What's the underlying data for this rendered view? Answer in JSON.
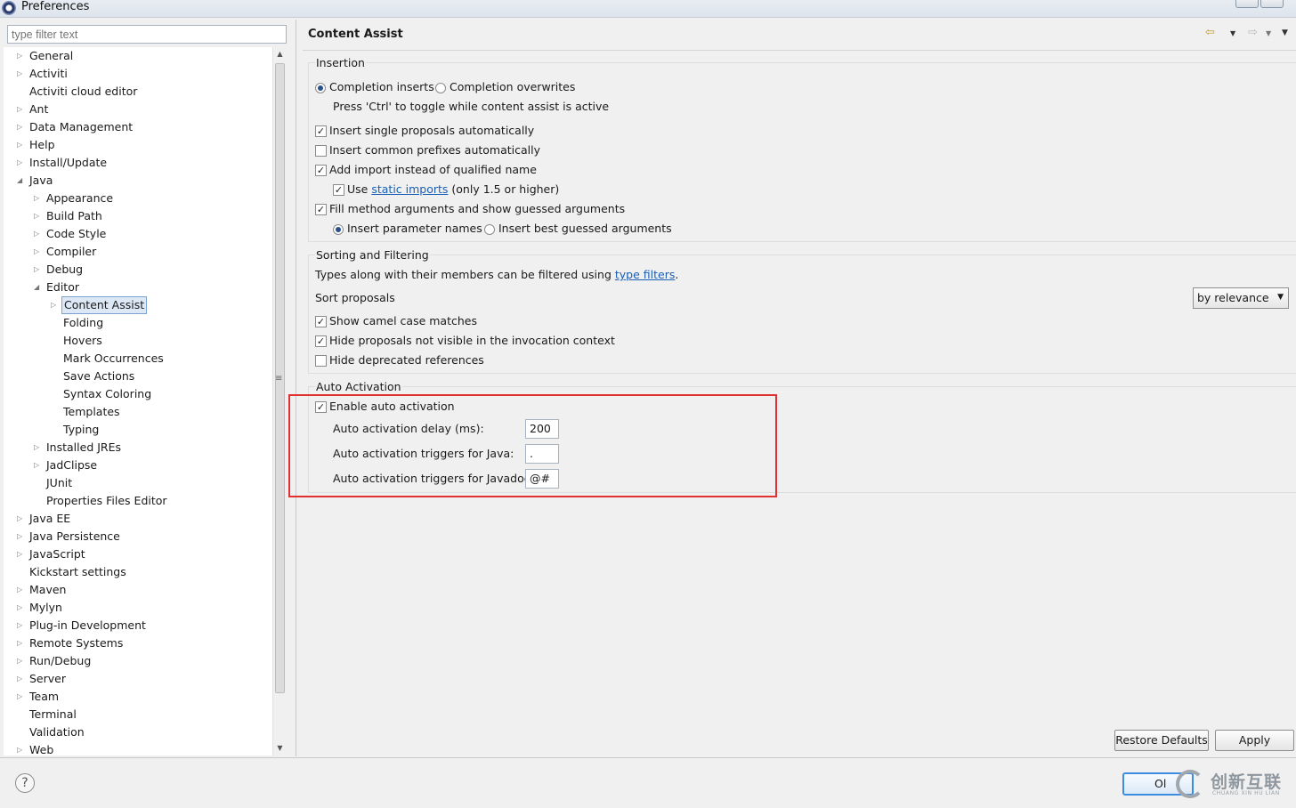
{
  "window": {
    "title": "Preferences",
    "icon": "eclipse-icon"
  },
  "filter": {
    "placeholder": "type filter text"
  },
  "tree": [
    {
      "label": "General",
      "level": 0,
      "arrow": "collapsed"
    },
    {
      "label": "Activiti",
      "level": 0,
      "arrow": "collapsed"
    },
    {
      "label": "Activiti cloud editor",
      "level": 0,
      "arrow": "none"
    },
    {
      "label": "Ant",
      "level": 0,
      "arrow": "collapsed"
    },
    {
      "label": "Data Management",
      "level": 0,
      "arrow": "collapsed"
    },
    {
      "label": "Help",
      "level": 0,
      "arrow": "collapsed"
    },
    {
      "label": "Install/Update",
      "level": 0,
      "arrow": "collapsed"
    },
    {
      "label": "Java",
      "level": 0,
      "arrow": "expanded"
    },
    {
      "label": "Appearance",
      "level": 1,
      "arrow": "collapsed"
    },
    {
      "label": "Build Path",
      "level": 1,
      "arrow": "collapsed"
    },
    {
      "label": "Code Style",
      "level": 1,
      "arrow": "collapsed"
    },
    {
      "label": "Compiler",
      "level": 1,
      "arrow": "collapsed"
    },
    {
      "label": "Debug",
      "level": 1,
      "arrow": "collapsed"
    },
    {
      "label": "Editor",
      "level": 1,
      "arrow": "expanded"
    },
    {
      "label": "Content Assist",
      "level": 2,
      "arrow": "collapsed",
      "selected": true
    },
    {
      "label": "Folding",
      "level": 2,
      "arrow": "none"
    },
    {
      "label": "Hovers",
      "level": 2,
      "arrow": "none"
    },
    {
      "label": "Mark Occurrences",
      "level": 2,
      "arrow": "none"
    },
    {
      "label": "Save Actions",
      "level": 2,
      "arrow": "none"
    },
    {
      "label": "Syntax Coloring",
      "level": 2,
      "arrow": "none"
    },
    {
      "label": "Templates",
      "level": 2,
      "arrow": "none"
    },
    {
      "label": "Typing",
      "level": 2,
      "arrow": "none"
    },
    {
      "label": "Installed JREs",
      "level": 1,
      "arrow": "collapsed"
    },
    {
      "label": "JadClipse",
      "level": 1,
      "arrow": "collapsed"
    },
    {
      "label": "JUnit",
      "level": 1,
      "arrow": "none"
    },
    {
      "label": "Properties Files Editor",
      "level": 1,
      "arrow": "none"
    },
    {
      "label": "Java EE",
      "level": 0,
      "arrow": "collapsed"
    },
    {
      "label": "Java Persistence",
      "level": 0,
      "arrow": "collapsed"
    },
    {
      "label": "JavaScript",
      "level": 0,
      "arrow": "collapsed"
    },
    {
      "label": "Kickstart settings",
      "level": 0,
      "arrow": "none"
    },
    {
      "label": "Maven",
      "level": 0,
      "arrow": "collapsed"
    },
    {
      "label": "Mylyn",
      "level": 0,
      "arrow": "collapsed"
    },
    {
      "label": "Plug-in Development",
      "level": 0,
      "arrow": "collapsed"
    },
    {
      "label": "Remote Systems",
      "level": 0,
      "arrow": "collapsed"
    },
    {
      "label": "Run/Debug",
      "level": 0,
      "arrow": "collapsed"
    },
    {
      "label": "Server",
      "level": 0,
      "arrow": "collapsed"
    },
    {
      "label": "Team",
      "level": 0,
      "arrow": "collapsed"
    },
    {
      "label": "Terminal",
      "level": 0,
      "arrow": "none"
    },
    {
      "label": "Validation",
      "level": 0,
      "arrow": "none"
    },
    {
      "label": "Web",
      "level": 0,
      "arrow": "collapsed"
    }
  ],
  "page": {
    "title": "Content Assist",
    "nav_icons": [
      "back-arrow-icon",
      "dropdown-icon",
      "forward-arrow-icon",
      "dropdown-icon",
      "view-menu-icon"
    ]
  },
  "insertion": {
    "title": "Insertion",
    "completion_inserts": "Completion inserts",
    "completion_overwrites": "Completion overwrites",
    "hint": "Press 'Ctrl' to toggle while content assist is active",
    "insert_single": "Insert single proposals automatically",
    "insert_common": "Insert common prefixes automatically",
    "add_import": "Add import instead of qualified name",
    "use_prefix": "Use",
    "static_imports_link": "static imports",
    "use_suffix": "(only 1.5 or higher)",
    "fill_method": "Fill method arguments and show guessed arguments",
    "insert_param_names": "Insert parameter names",
    "insert_best_guessed": "Insert best guessed arguments"
  },
  "sorting": {
    "title": "Sorting and Filtering",
    "types_prefix": "Types along with their members can be filtered using",
    "type_filters_link": "type filters",
    "types_suffix": ".",
    "sort_label": "Sort proposals",
    "sort_value": "by relevance",
    "camel_case": "Show camel case matches",
    "hide_not_visible": "Hide proposals not visible in the invocation context",
    "hide_deprecated": "Hide deprecated references"
  },
  "auto": {
    "title": "Auto Activation",
    "enable": "Enable auto activation",
    "delay_label": "Auto activation delay (ms):",
    "delay_value": "200",
    "java_label": "Auto activation triggers for Java:",
    "java_value": ".",
    "javadoc_label": "Auto activation triggers for Javadoc:",
    "javadoc_value": "@#"
  },
  "buttons": {
    "restore_defaults": "Restore Defaults",
    "apply": "Apply",
    "ok": "Ol",
    "help": "?"
  },
  "watermark": {
    "text": "创新互联",
    "sub": "CHUANG XIN HU LIAN"
  },
  "colors": {
    "highlight": "#e03030",
    "link": "#1a5fb4",
    "selection": "#dde8f7"
  }
}
